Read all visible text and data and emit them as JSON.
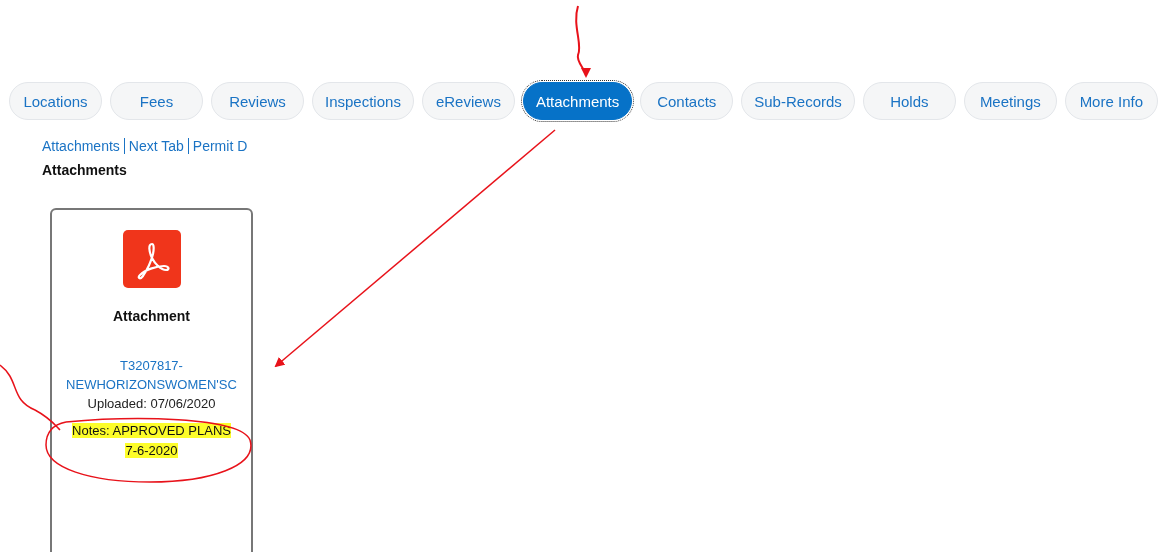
{
  "tabs": [
    {
      "label": "Locations",
      "selected": false
    },
    {
      "label": "Fees",
      "selected": false
    },
    {
      "label": "Reviews",
      "selected": false
    },
    {
      "label": "Inspections",
      "selected": false
    },
    {
      "label": "eReviews",
      "selected": false
    },
    {
      "label": "Attachments",
      "selected": true
    },
    {
      "label": "Contacts",
      "selected": false
    },
    {
      "label": "Sub-Records",
      "selected": false
    },
    {
      "label": "Holds",
      "selected": false
    },
    {
      "label": "Meetings",
      "selected": false
    },
    {
      "label": "More Info",
      "selected": false
    }
  ],
  "breadcrumb": [
    "Attachments",
    "Next Tab",
    "Permit D"
  ],
  "section_title": "Attachments",
  "attachments": [
    {
      "title": "Attachment",
      "file_name": "T3207817-NEWHORIZONSWOMEN'SC",
      "uploaded": "Uploaded: 07/06/2020",
      "notes": "Notes: APPROVED PLANS 7-6-2020",
      "highlighted": true
    }
  ]
}
